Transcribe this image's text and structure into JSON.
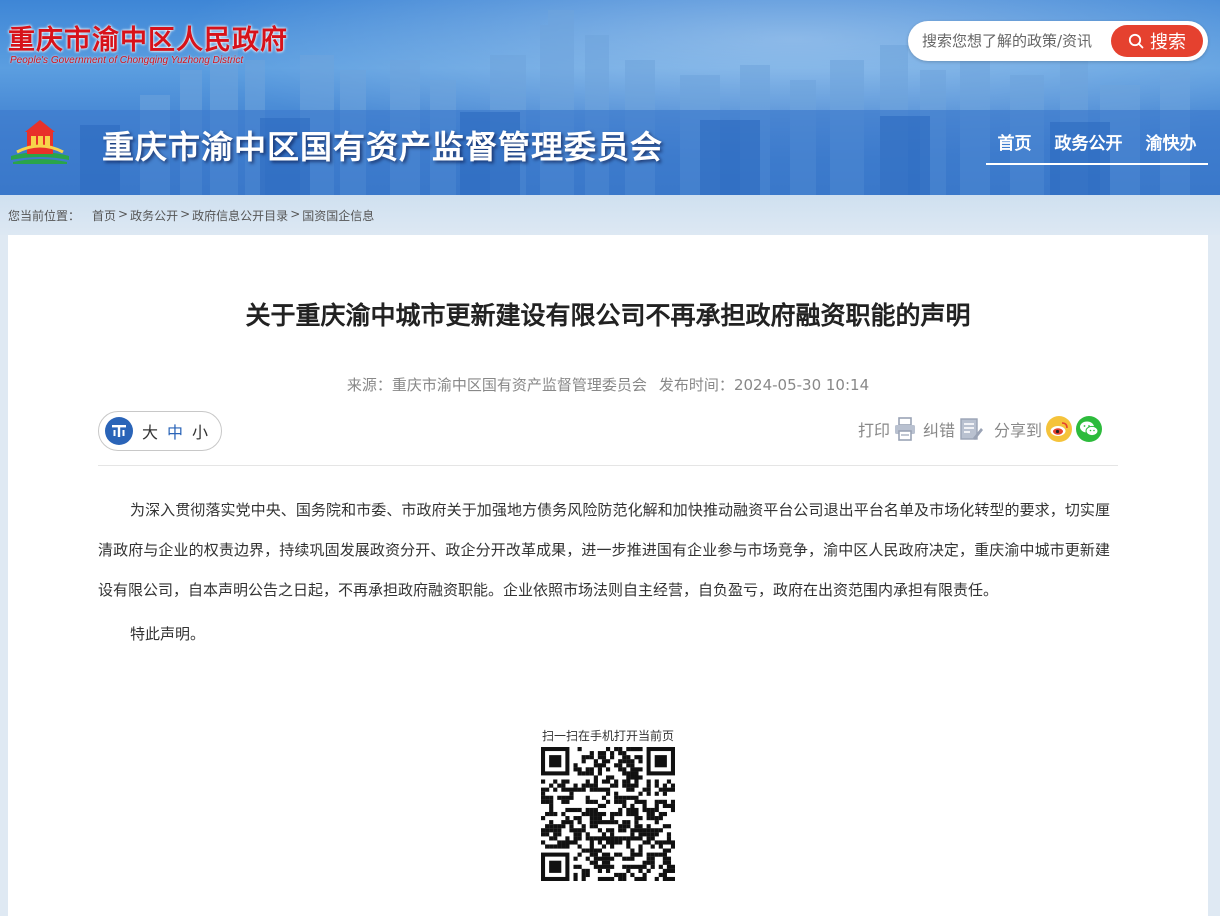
{
  "header": {
    "gov_name": "重庆市渝中区人民政府",
    "gov_name_en": "People's Government of Chongqing Yuzhong District",
    "site_title": "重庆市渝中区国有资产监督管理委员会",
    "search": {
      "placeholder": "搜索您想了解的政策/资讯",
      "button_label": "搜索"
    },
    "nav": [
      {
        "label": "首页"
      },
      {
        "label": "政务公开"
      },
      {
        "label": "渝快办"
      }
    ],
    "colors": {
      "brand_red": "#d7121a",
      "search_button": "#e5412f",
      "sky_blue": "#3e86d6"
    }
  },
  "breadcrumb": {
    "label": "您当前位置：",
    "items": [
      "首页",
      "政务公开",
      "政府信息公开目录",
      "国资国企信息"
    ],
    "separator": ">"
  },
  "article": {
    "title": "关于重庆渝中城市更新建设有限公司不再承担政府融资职能的声明",
    "source_label": "来源：",
    "source": "重庆市渝中区国有资产监督管理委员会",
    "time_label": "发布时间：",
    "time": "2024-05-30 10:14",
    "paragraphs": [
      "为深入贯彻落实党中央、国务院和市委、市政府关于加强地方债务风险防范化解和加快推动融资平台公司退出平台名单及市场化转型的要求，切实厘清政府与企业的权责边界，持续巩固发展政资分开、政企分开改革成果，进一步推进国有企业参与市场竞争，渝中区人民政府决定，重庆渝中城市更新建设有限公司，自本声明公告之日起，不再承担政府融资职能。企业依照市场法则自主经营，自负盈亏，政府在出资范围内承担有限责任。",
      "特此声明。"
    ]
  },
  "toolbar": {
    "font_sizes": [
      "大",
      "中",
      "小"
    ],
    "print_label": "打印",
    "correct_label": "纠错",
    "share_label": "分享到",
    "icons": [
      "font-size-icon",
      "print-icon",
      "correction-icon",
      "weibo-icon",
      "wechat-icon"
    ]
  },
  "qr": {
    "caption": "扫一扫在手机打开当前页"
  }
}
